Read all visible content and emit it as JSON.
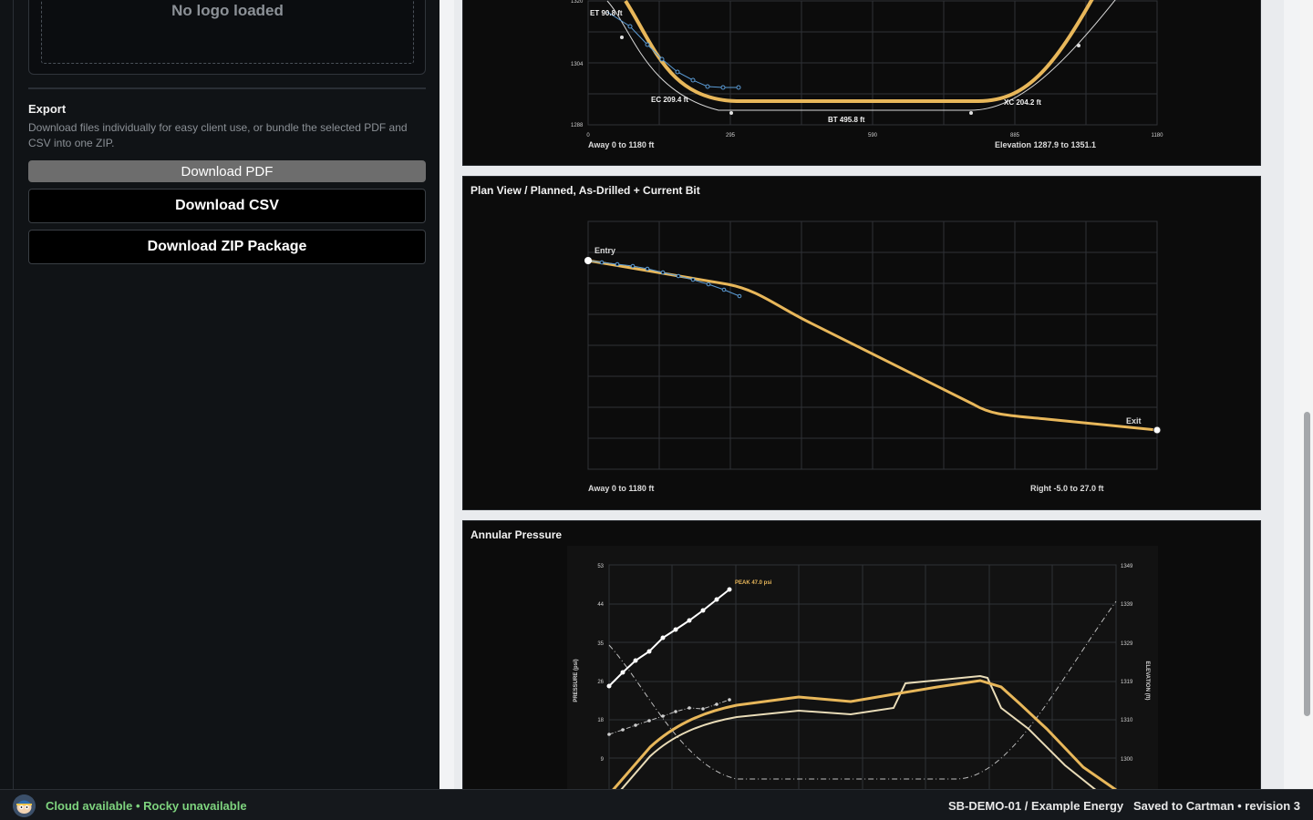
{
  "sidebar": {
    "logo_placeholder": "No logo loaded",
    "export": {
      "title": "Export",
      "description": "Download files individually for easy client use, or bundle the selected PDF and CSV into one ZIP.",
      "pdf_label": "Download PDF",
      "csv_label": "Download CSV",
      "zip_label": "Download ZIP Package"
    }
  },
  "profile": {
    "y_ticks": [
      "1320",
      "1304",
      "1288"
    ],
    "x_ticks": [
      "0",
      "295",
      "590",
      "885",
      "1180"
    ],
    "labels": {
      "et": "ET 90.8 ft",
      "ec": "EC 209.4 ft",
      "bt": "BT 495.8 ft",
      "xc": "XC 204.2 ft"
    },
    "footer_left": "Away 0 to 1180 ft",
    "footer_right": "Elevation 1287.9 to 1351.1"
  },
  "plan": {
    "title": "Plan View / Planned, As-Drilled + Current Bit",
    "entry_label": "Entry",
    "exit_label": "Exit",
    "footer_left": "Away 0 to 1180 ft",
    "footer_right": "Right -5.0 to 27.0 ft"
  },
  "pressure": {
    "title": "Annular Pressure",
    "y_left_ticks": [
      "53",
      "44",
      "35",
      "26",
      "18",
      "9"
    ],
    "y_right_ticks": [
      "1349",
      "1339",
      "1329",
      "1319",
      "1310",
      "1300"
    ],
    "y_left_label": "PRESSURE (psi)",
    "y_right_label": "ELEVATION (ft)",
    "peak_label": "PEAK 47.0 psi"
  },
  "colors": {
    "planned": "#e8b75a",
    "drilled": "#5b9bd5",
    "status_ok": "#7ed37e"
  },
  "status": {
    "connection": "Cloud available • Rocky unavailable",
    "project": "SB-DEMO-01 / Example Energy",
    "saved": "Saved to Cartman • revision 3"
  }
}
